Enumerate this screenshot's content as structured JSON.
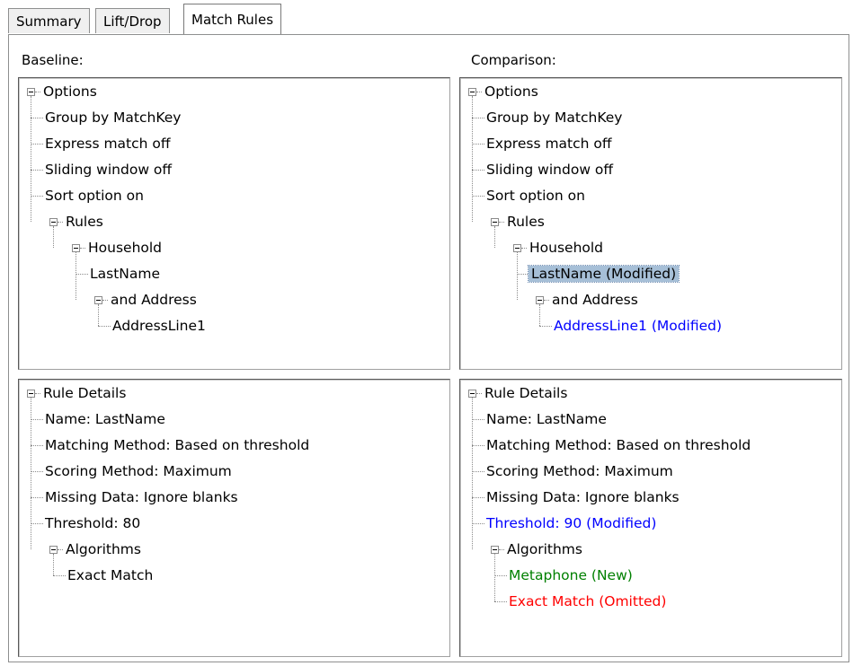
{
  "tabs": [
    {
      "label": "Summary"
    },
    {
      "label": "Lift/Drop"
    },
    {
      "label": "Match Rules"
    }
  ],
  "labels": {
    "baseline": "Baseline:",
    "comparison": "Comparison:"
  },
  "baseline_rules": [
    {
      "label": "Options",
      "expanded": true
    },
    {
      "label": "Group by MatchKey"
    },
    {
      "label": "Express match off"
    },
    {
      "label": "Sliding window off"
    },
    {
      "label": "Sort option on"
    },
    {
      "label": "Rules",
      "expanded": true
    },
    {
      "label": "Household",
      "expanded": true
    },
    {
      "label": "LastName"
    },
    {
      "label": "and Address",
      "expanded": true
    },
    {
      "label": "AddressLine1"
    }
  ],
  "comparison_rules": [
    {
      "label": "Options",
      "expanded": true
    },
    {
      "label": "Group by MatchKey"
    },
    {
      "label": "Express match off"
    },
    {
      "label": "Sliding window off"
    },
    {
      "label": "Sort option on"
    },
    {
      "label": "Rules",
      "expanded": true
    },
    {
      "label": "Household",
      "expanded": true
    },
    {
      "label": "LastName (Modified)",
      "selected": true
    },
    {
      "label": "and Address",
      "expanded": true
    },
    {
      "label": "AddressLine1 (Modified)",
      "status": "modified"
    }
  ],
  "baseline_details": [
    {
      "label": "Rule Details",
      "expanded": true
    },
    {
      "label": "Name: LastName"
    },
    {
      "label": "Matching Method: Based on threshold"
    },
    {
      "label": "Scoring Method: Maximum"
    },
    {
      "label": "Missing Data: Ignore blanks"
    },
    {
      "label": "Threshold: 80"
    },
    {
      "label": "Algorithms",
      "expanded": true
    },
    {
      "label": "Exact Match"
    }
  ],
  "comparison_details": [
    {
      "label": "Rule Details",
      "expanded": true
    },
    {
      "label": "Name: LastName"
    },
    {
      "label": "Matching Method: Based on threshold"
    },
    {
      "label": "Scoring Method: Maximum"
    },
    {
      "label": "Missing Data: Ignore blanks"
    },
    {
      "label": "Threshold: 90 (Modified)",
      "status": "modified"
    },
    {
      "label": "Algorithms",
      "expanded": true
    },
    {
      "label": "Metaphone (New)",
      "status": "new"
    },
    {
      "label": "Exact Match (Omitted)",
      "status": "omitted"
    }
  ],
  "colors": {
    "modified": "#0000ff",
    "new": "#008000",
    "omitted": "#ff0000",
    "selection": "#a6bfd7"
  }
}
